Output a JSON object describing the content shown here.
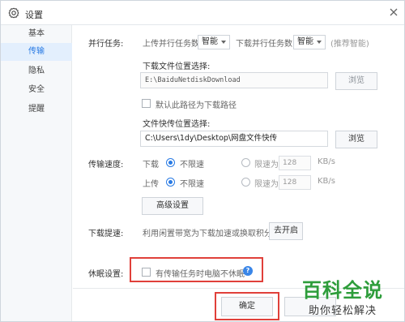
{
  "window": {
    "title": "设置"
  },
  "sidebar": {
    "items": [
      {
        "label": "基本",
        "active": false
      },
      {
        "label": "传输",
        "active": true
      },
      {
        "label": "隐私",
        "active": false
      },
      {
        "label": "安全",
        "active": false
      },
      {
        "label": "提醒",
        "active": false
      }
    ]
  },
  "parallel": {
    "section_label": "并行任务:",
    "upload_label": "上传并行任务数",
    "upload_value": "智能",
    "download_label": "下载并行任务数",
    "download_value": "智能",
    "hint": "(推荐智能)"
  },
  "download_location": {
    "label": "下载文件位置选择:",
    "path": "E:\\BaiduNetdiskDownload",
    "browse_label": "浏览",
    "default_checkbox_label": "默认此路径为下载路径",
    "default_checked": false
  },
  "quick_transfer": {
    "label": "文件快传位置选择:",
    "path": "C:\\Users\\1dy\\Desktop\\网盘文件快传",
    "browse_label": "浏览"
  },
  "speed": {
    "section_label": "传输速度:",
    "download_label": "下载",
    "upload_label": "上传",
    "unlimited_label": "不限速",
    "limit_label": "限速为",
    "download_limit_value": "128",
    "upload_limit_value": "128",
    "unit": "KB/s",
    "download_mode": "unlimited",
    "upload_mode": "unlimited",
    "advanced_label": "高级设置"
  },
  "boost": {
    "section_label": "下载提速:",
    "description": "利用闲置带宽为下载加速或换取积分",
    "button_label": "去开启"
  },
  "sleep": {
    "section_label": "休眠设置:",
    "checkbox_label": "有传输任务时电脑不休眠",
    "checked": false,
    "help_glyph": "?"
  },
  "footer": {
    "ok_label": "确定",
    "cancel_label": ""
  },
  "watermark": {
    "title": "百科全说",
    "subtitle": "助你轻松解决"
  },
  "colors": {
    "accent": "#2a7be4",
    "highlight_box": "#e0403a",
    "watermark_green": "#2e9d3b"
  }
}
